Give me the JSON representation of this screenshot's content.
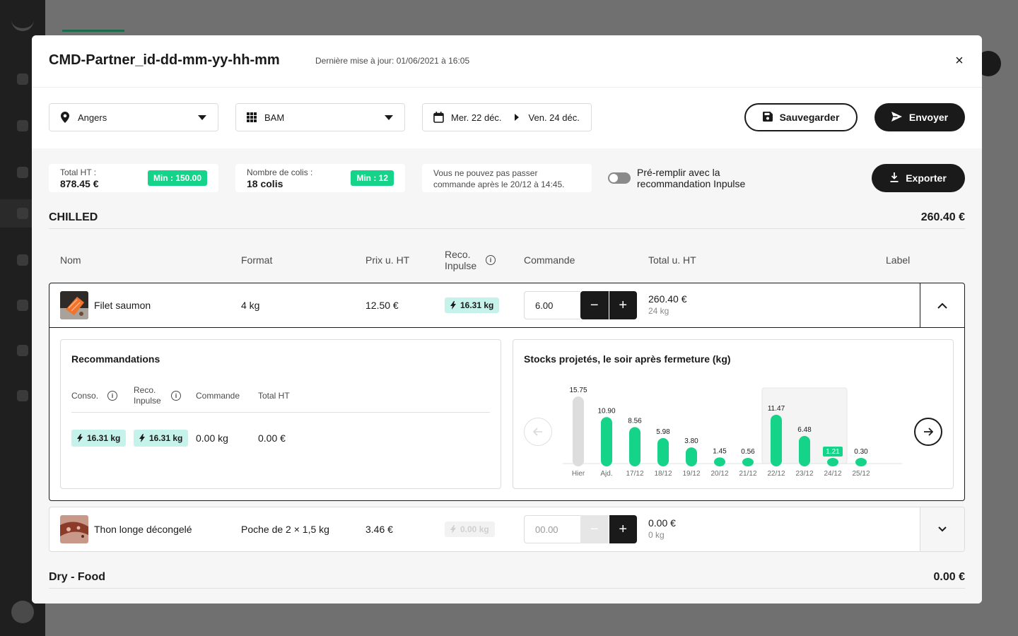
{
  "modal": {
    "title": "CMD-Partner_id-dd-mm-yy-hh-mm",
    "last_update": "Dernière mise à jour: 01/06/2021 à 16:05",
    "close_icon": "×"
  },
  "toolbar": {
    "location": "Angers",
    "brand": "BAM",
    "date_from": "Mer. 22 déc.",
    "date_to": "Ven. 24 déc.",
    "save_label": "Sauvegarder",
    "send_label": "Envoyer"
  },
  "summary": {
    "total_label": "Total HT :",
    "total_value": "878.45 €",
    "total_min": "Min : 150.00",
    "colis_label": "Nombre de colis :",
    "colis_value": "18 colis",
    "colis_min": "Min : 12",
    "notice": "Vous ne pouvez pas passer commande après le 20/12 à 14:45.",
    "prefill_label": "Pré-remplir avec la recommandation Inpulse",
    "prefill_on": false,
    "export_label": "Exporter"
  },
  "sections": {
    "chilled_name": "CHILLED",
    "chilled_total": "260.40 €",
    "dry_name": "Dry - Food",
    "dry_total": "0.00 €"
  },
  "columns": {
    "name": "Nom",
    "format": "Format",
    "price": "Prix u. HT",
    "reco_1": "Reco.",
    "reco_2": "Inpulse",
    "order": "Commande",
    "total": "Total u. HT",
    "label": "Label"
  },
  "products": [
    {
      "name": "Filet saumon",
      "format": "4 kg",
      "price": "12.50 €",
      "reco": "16.31 kg",
      "quantity": "6.00",
      "total": "260.40 €",
      "total_kg": "24 kg"
    },
    {
      "name": "Thon longe décongelé",
      "format": "Poche de 2 × 1,5 kg",
      "price": "3.46 €",
      "reco": "0.00 kg",
      "quantity_placeholder": "00.00",
      "total": "0.00 €",
      "total_kg": "0 kg"
    }
  ],
  "recommendations": {
    "title": "Recommandations",
    "col_conso": "Conso.",
    "col_reco_1": "Reco.",
    "col_reco_2": "Inpulse",
    "col_order": "Commande",
    "col_total": "Total HT",
    "conso": "16.31 kg",
    "reco": "16.31 kg",
    "order": "0.00 kg",
    "total": "0.00 €"
  },
  "stock_chart": {
    "title": "Stocks projetés, le soir après fermeture (kg)"
  },
  "chart_data": {
    "type": "bar",
    "title": "Stocks projetés, le soir après fermeture (kg)",
    "categories": [
      "Hier",
      "Ajd.",
      "17/12",
      "18/12",
      "19/12",
      "20/12",
      "21/12",
      "22/12",
      "23/12",
      "24/12",
      "25/12"
    ],
    "values": [
      15.75,
      10.9,
      8.56,
      5.98,
      3.8,
      1.45,
      0.56,
      11.47,
      6.48,
      1.21,
      0.3
    ],
    "value_labels": [
      "15.75",
      "10.90",
      "8.56",
      "5.98",
      "3.80",
      "1.45",
      "0.56",
      "11.47",
      "6.48",
      "1.21",
      "0.30"
    ],
    "highlight_range": [
      "22/12",
      "24/12"
    ],
    "colors": {
      "past": "#dddddd",
      "future": "#15d48a",
      "highlight_bg": "#f4f4f4"
    }
  },
  "colors": {
    "accent_green": "#15d48a",
    "reco_badge": "#c5f2ea",
    "dark": "#1a1a1a"
  }
}
